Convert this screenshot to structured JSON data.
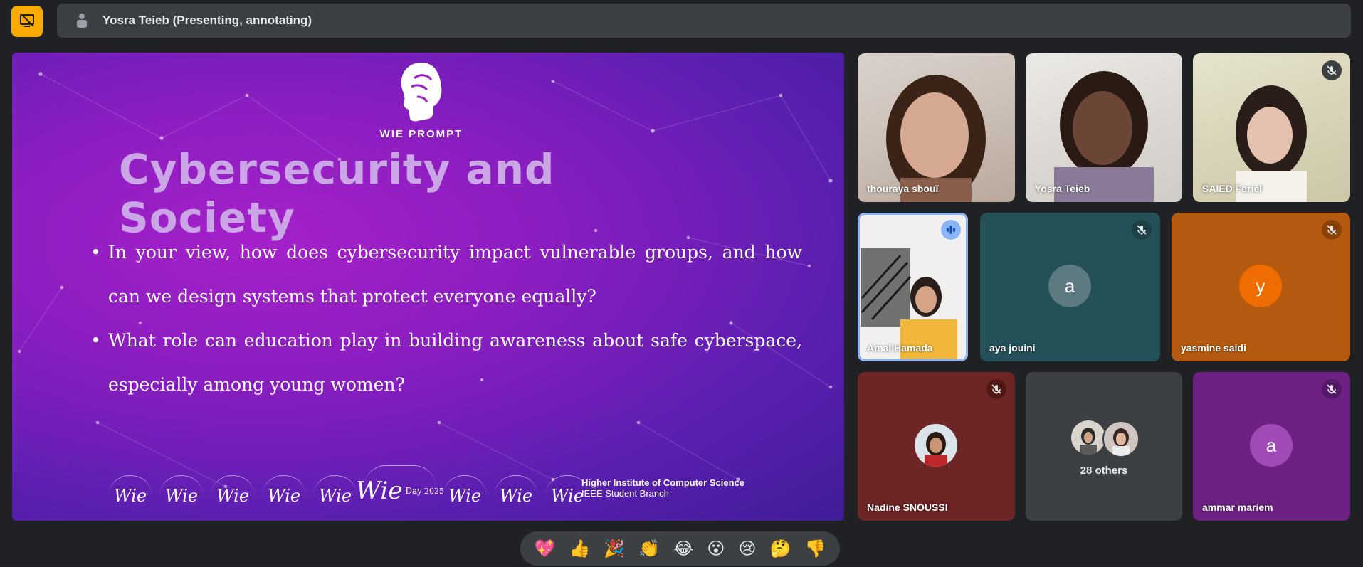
{
  "presenter_bar": {
    "label": "Yosra Teieb (Presenting, annotating)"
  },
  "slide": {
    "logo_caption": "WIE PROMPT",
    "title": "Cybersecurity and Society",
    "bullets": [
      "In your view, how does cybersecurity impact vulnerable groups, and how can we design systems that protect everyone equally?",
      "What role can education play in building awareness about safe cyberspace, especially among young women?"
    ],
    "sponsor_badges": [
      "Wie",
      "Wie",
      "Wie",
      "Wie",
      "Wie",
      "Wie",
      "Wie",
      "Wie",
      "Wie"
    ],
    "event_badge": {
      "text": "Wie",
      "day": "Day",
      "year": "2025",
      "ring": "IEEE Women in Engineering"
    },
    "institution_name": "Higher Institute of Computer Science",
    "institution_sub": "IEEE Student Branch"
  },
  "participants": [
    {
      "name": "thouraya sbouï",
      "muted": false,
      "kind": "video"
    },
    {
      "name": "Yosra Teieb",
      "muted": false,
      "kind": "video"
    },
    {
      "name": "SAIED Feriel",
      "muted": true,
      "kind": "video"
    },
    {
      "name": "Amal Hamada",
      "muted": false,
      "speaking": true,
      "kind": "video"
    },
    {
      "name": "aya jouini",
      "muted": true,
      "kind": "letter",
      "letter": "a",
      "color": "#245058"
    },
    {
      "name": "yasmine saidi",
      "muted": true,
      "kind": "letter",
      "letter": "y",
      "color": "#b35a10"
    },
    {
      "name": "Nadine SNOUSSI",
      "muted": true,
      "kind": "photo",
      "color": "#6e2525"
    },
    {
      "name": "28 others",
      "kind": "others"
    },
    {
      "name": "ammar mariem",
      "muted": true,
      "kind": "letter",
      "letter": "a",
      "color": "#6d2182"
    }
  ],
  "reactions": [
    "💖",
    "👍",
    "🎉",
    "👏",
    "😂",
    "😮",
    "😢",
    "🤔",
    "👎"
  ],
  "colors": {
    "accent": "#f9ab00",
    "background": "#202124",
    "bar": "#3c4043",
    "speaking": "#8ab4f8"
  },
  "icons": {
    "stop": "stop-presenting-icon",
    "muted": "mic-off-icon",
    "speaking": "audio-wave-icon"
  }
}
